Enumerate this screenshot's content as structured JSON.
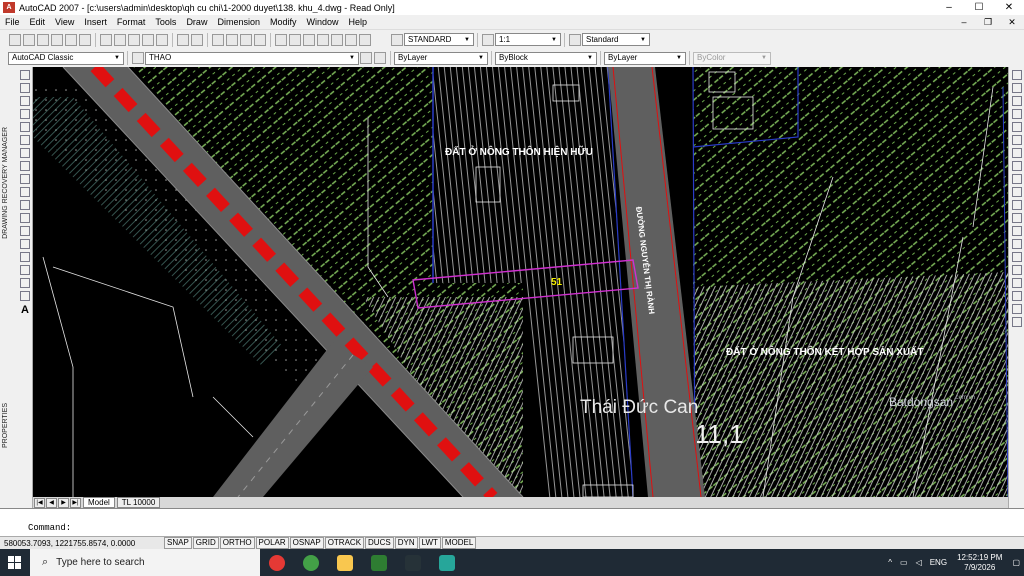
{
  "window": {
    "title": "AutoCAD 2007 - [c:\\users\\admin\\desktop\\qh cu chi\\1-2000 duyet\\138. khu_4.dwg - Read Only]",
    "app_icon": "A",
    "minimize": "–",
    "maximize": "☐",
    "close": "✕"
  },
  "menu": {
    "items": [
      "File",
      "Edit",
      "View",
      "Insert",
      "Format",
      "Tools",
      "Draw",
      "Dimension",
      "Modify",
      "Window",
      "Help"
    ],
    "mdi_min": "–",
    "mdi_restore": "❐",
    "mdi_close": "✕"
  },
  "toolbar": {
    "text_style": "STANDARD",
    "scale": "1:1",
    "dim_style": "Standard"
  },
  "properties_bar": {
    "workspace": "AutoCAD Classic",
    "layer": "THAO",
    "color": "ByLayer",
    "linetype": "ByBlock",
    "lineweight": "ByLayer",
    "plotstyle": "ByColor"
  },
  "palettes": {
    "recovery": "DRAWING RECOVERY MANAGER",
    "properties": "PROPERTIES"
  },
  "drawing": {
    "label_existing": "ĐẤT Ở NÔNG THÔN HIỆN HỮU",
    "label_mixed": "ĐẤT Ở NÔNG THÔN KẾT HỢP SẢN XUẤT",
    "road_name": "ĐƯỜNG NGUYỄN THỊ RÀNH",
    "parcel_number": "51",
    "colors": {
      "hatch_green": "#7db85a",
      "hatch_white": "#cfcfcf",
      "road_gray": "#5f5f5f",
      "road_red": "#e01010",
      "parcel_magenta": "#d030d0",
      "boundary_blue": "#2a3cc8"
    }
  },
  "watermark": {
    "name": "Thái Đức Can",
    "number": "11,1",
    "brand": "Batdongsan",
    "brand_suffix": ".com.vn"
  },
  "tabs": {
    "model": "Model",
    "layout": "TL 10000",
    "nav": [
      "|◀",
      "◀",
      "▶",
      "▶|"
    ]
  },
  "command": {
    "prompt": "Command:"
  },
  "status": {
    "coords": "580053.7093, 1221755.8574, 0.0000",
    "toggles": [
      "SNAP",
      "GRID",
      "ORTHO",
      "POLAR",
      "OSNAP",
      "OTRACK",
      "DUCS",
      "DYN",
      "LWT",
      "MODEL"
    ]
  },
  "taskbar": {
    "search_placeholder": "Type here to search",
    "language": "ENG",
    "time": "12:52:19 PM",
    "date": "7/9/2026"
  }
}
